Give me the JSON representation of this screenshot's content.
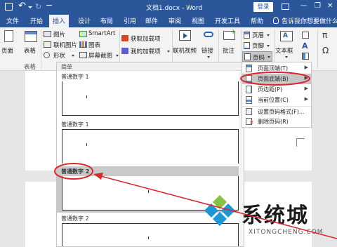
{
  "title_bar": {
    "doc_title": "文档1.docx  -  Word",
    "login_label": "登录",
    "undo_glyph": "↶",
    "redo_glyph": "↻",
    "min_glyph": "—",
    "max_glyph": "❐",
    "close_glyph": "✕"
  },
  "tabs": [
    "文件",
    "开始",
    "插入",
    "设计",
    "布局",
    "引用",
    "邮件",
    "审阅",
    "视图",
    "开发工具",
    "帮助"
  ],
  "tell_me": "告诉我你想要做什么",
  "ribbon": {
    "pages_label": "页面",
    "table_label": "表格",
    "table_group_label": "表格",
    "pictures_label": "图片",
    "online_pictures_label": "联机图片",
    "shapes_label": "形状",
    "smartart_label": "SmartArt",
    "chart_label": "图表",
    "screenshot_label": "屏幕截图",
    "get_addins_label": "获取加载项",
    "my_addins_label": "我的加载项",
    "online_video_label": "联机视频",
    "link_label": "链接",
    "comment_label": "批注",
    "header_label": "页眉",
    "footer_label": "页脚",
    "page_number_label": "页码",
    "textbox_label": "文本框"
  },
  "gallery": {
    "header": "简单",
    "items": [
      {
        "label": "普通数字 1"
      },
      {
        "label": "普通数字 1"
      },
      {
        "label": "普通数字 2"
      },
      {
        "label": "普通数字 2"
      }
    ]
  },
  "page_number_menu": {
    "items": [
      {
        "label": "页面顶端(T)",
        "icon": "page-top-icon",
        "has_submenu": true
      },
      {
        "label": "页面底端(B)",
        "icon": "page-bottom-icon",
        "has_submenu": true
      },
      {
        "label": "页边距(P)",
        "icon": "page-margin-icon",
        "has_submenu": true
      },
      {
        "label": "当前位置(C)",
        "icon": "current-position-icon",
        "has_submenu": true
      },
      {
        "label": "设置页码格式(F)...",
        "icon": "format-page-number-icon",
        "has_submenu": false
      },
      {
        "label": "删除页码(R)",
        "icon": "remove-page-number-icon",
        "has_submenu": false
      }
    ]
  },
  "watermark": {
    "brand": "系统城",
    "url": "XITONGCHENG.COM"
  },
  "colors": {
    "word_blue": "#2b579a",
    "annotation_red": "#d9262c",
    "highlight_gray": "#c9c9c9"
  }
}
